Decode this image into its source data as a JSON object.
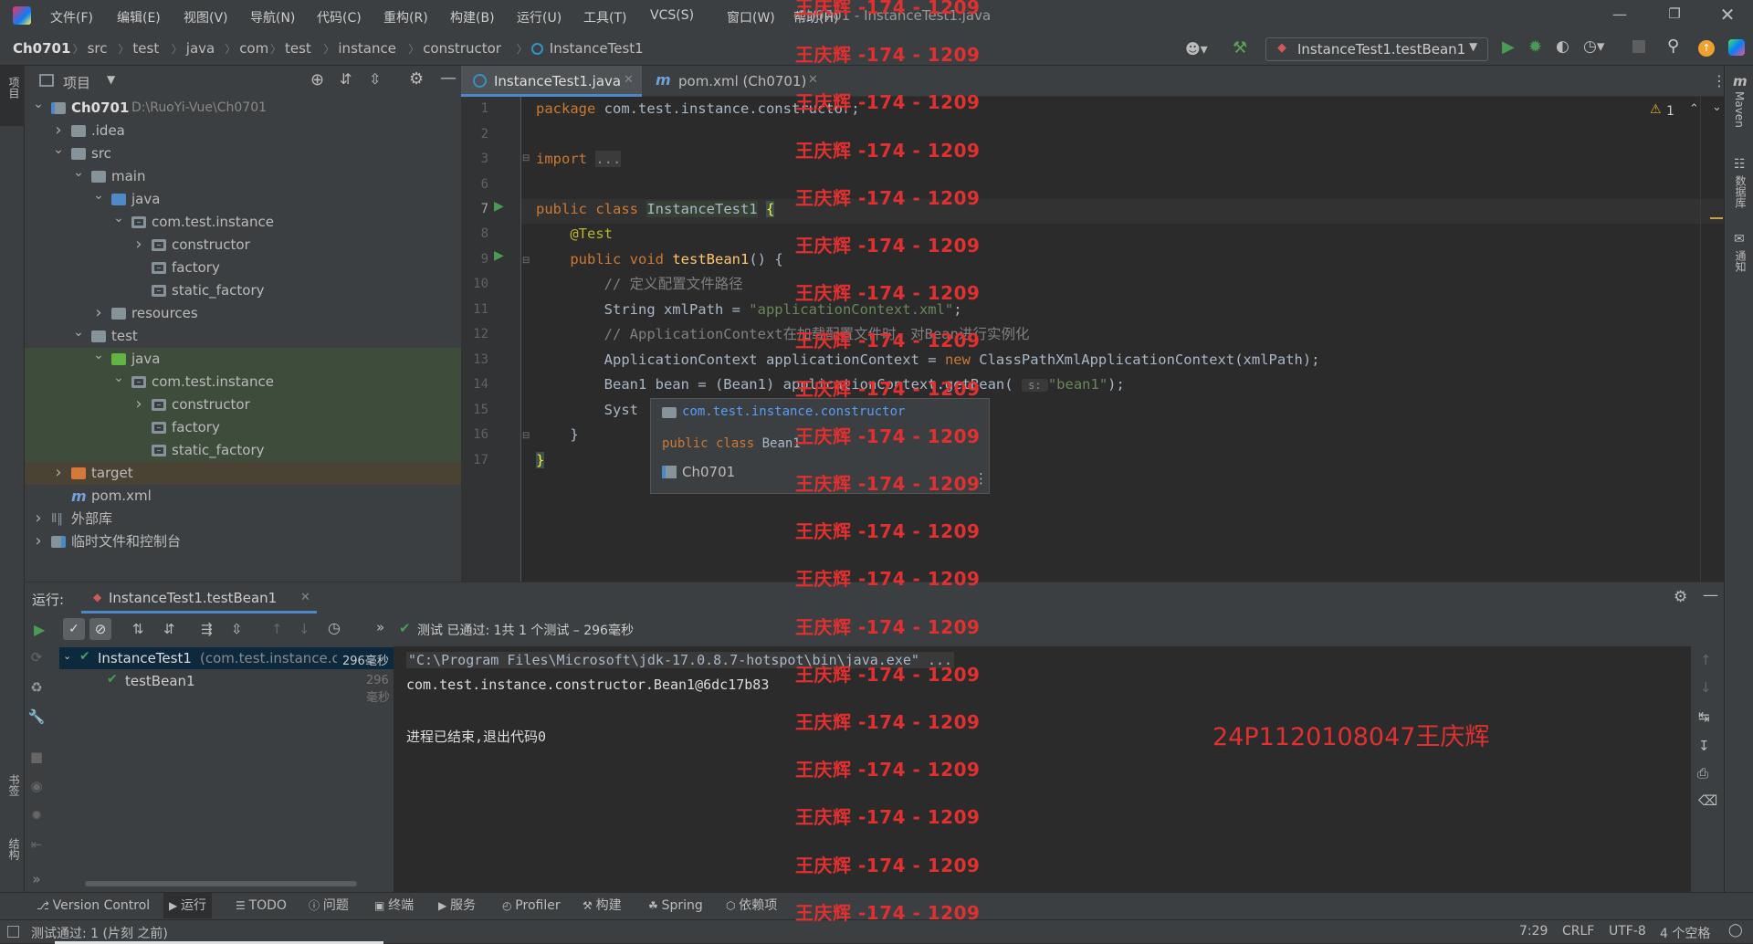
{
  "window": {
    "title": "Ch0701 - InstanceTest1.java",
    "menu": [
      "文件(F)",
      "编辑(E)",
      "视图(V)",
      "导航(N)",
      "代码(C)",
      "重构(R)",
      "构建(B)",
      "运行(U)",
      "工具(T)",
      "VCS(S)",
      "窗口(W)",
      "帮助(H)"
    ]
  },
  "breadcrumb": [
    "Ch0701",
    "src",
    "test",
    "java",
    "com",
    "test",
    "instance",
    "constructor",
    "InstanceTest1"
  ],
  "run_config": "InstanceTest1.testBean1",
  "project_panel": {
    "title": "项目",
    "tree": [
      {
        "label": "Ch0701",
        "extra": "D:\\RuoYi-Vue\\Ch0701",
        "depth": 0,
        "arrow": "open",
        "type": "module",
        "bold": true
      },
      {
        "label": ".idea",
        "depth": 1,
        "arrow": "closed",
        "type": "folder"
      },
      {
        "label": "src",
        "depth": 1,
        "arrow": "open",
        "type": "folder"
      },
      {
        "label": "main",
        "depth": 2,
        "arrow": "open",
        "type": "folder"
      },
      {
        "label": "java",
        "depth": 3,
        "arrow": "open",
        "type": "blue"
      },
      {
        "label": "com.test.instance",
        "depth": 4,
        "arrow": "open",
        "type": "pkg"
      },
      {
        "label": "constructor",
        "depth": 5,
        "arrow": "closed",
        "type": "pkg"
      },
      {
        "label": "factory",
        "depth": 5,
        "arrow": "none",
        "type": "pkg"
      },
      {
        "label": "static_factory",
        "depth": 5,
        "arrow": "none",
        "type": "pkg"
      },
      {
        "label": "resources",
        "depth": 3,
        "arrow": "closed",
        "type": "folder"
      },
      {
        "label": "test",
        "depth": 2,
        "arrow": "open",
        "type": "folder"
      },
      {
        "label": "java",
        "depth": 3,
        "arrow": "open",
        "type": "green",
        "hl": "green"
      },
      {
        "label": "com.test.instance",
        "depth": 4,
        "arrow": "open",
        "type": "pkg",
        "hl": "green"
      },
      {
        "label": "constructor",
        "depth": 5,
        "arrow": "closed",
        "type": "pkg",
        "hl": "green"
      },
      {
        "label": "factory",
        "depth": 5,
        "arrow": "none",
        "type": "pkg",
        "hl": "green"
      },
      {
        "label": "static_factory",
        "depth": 5,
        "arrow": "none",
        "type": "pkg",
        "hl": "green"
      },
      {
        "label": "target",
        "depth": 1,
        "arrow": "closed",
        "type": "orange",
        "hl": "brown"
      },
      {
        "label": "pom.xml",
        "depth": 1,
        "arrow": "none",
        "type": "maven"
      },
      {
        "label": "外部库",
        "depth": 0,
        "arrow": "closed",
        "type": "lib"
      },
      {
        "label": "临时文件和控制台",
        "depth": 0,
        "arrow": "closed",
        "type": "scratch"
      }
    ]
  },
  "editor": {
    "tabs": [
      {
        "label": "InstanceTest1.java",
        "active": true
      },
      {
        "label": "pom.xml (Ch0701)",
        "active": false
      }
    ],
    "warning_count": "1",
    "line_numbers": [
      "1",
      "2",
      "3",
      "6",
      "7",
      "8",
      "9",
      "10",
      "11",
      "12",
      "13",
      "14",
      "15",
      "16",
      "17"
    ],
    "popup": {
      "package": "com.test.instance.constructor",
      "declaration": "public class Bean1",
      "module": "Ch0701"
    }
  },
  "run_panel": {
    "label": "运行:",
    "tab": "InstanceTest1.testBean1",
    "status": "测试 已通过: 1共 1 个测试 – 296毫秒",
    "tests": [
      {
        "name": "InstanceTest1",
        "detail": "(com.test.instance.cc",
        "time": "296毫秒"
      },
      {
        "name": "testBean1",
        "detail": "",
        "time": "296毫秒"
      }
    ],
    "console": [
      "\"C:\\Program Files\\Microsoft\\jdk-17.0.8.7-hotspot\\bin\\java.exe\" ...",
      "com.test.instance.constructor.Bean1@6dc17b83",
      "",
      "进程已结束,退出代码0"
    ]
  },
  "bottom_tabs": [
    "Version Control",
    "运行",
    "TODO",
    "问题",
    "终端",
    "服务",
    "Profiler",
    "构建",
    "Spring",
    "依赖项"
  ],
  "status_bar": {
    "message": "测试通过: 1 (片刻 之前)",
    "position": "7:29",
    "line_sep": "CRLF",
    "encoding": "UTF-8",
    "indent": "4 个空格"
  },
  "left_strip": [
    "项目",
    "书签",
    "结构"
  ],
  "right_strip": [
    "Maven",
    "数据库",
    "通知"
  ],
  "watermark": {
    "repeat": "王庆辉 -174 - 1209",
    "id": "24P1120108047王庆辉"
  },
  "colors": {
    "accent": "#4a88c7",
    "pass": "#499c54",
    "watermark": "#e03030"
  }
}
